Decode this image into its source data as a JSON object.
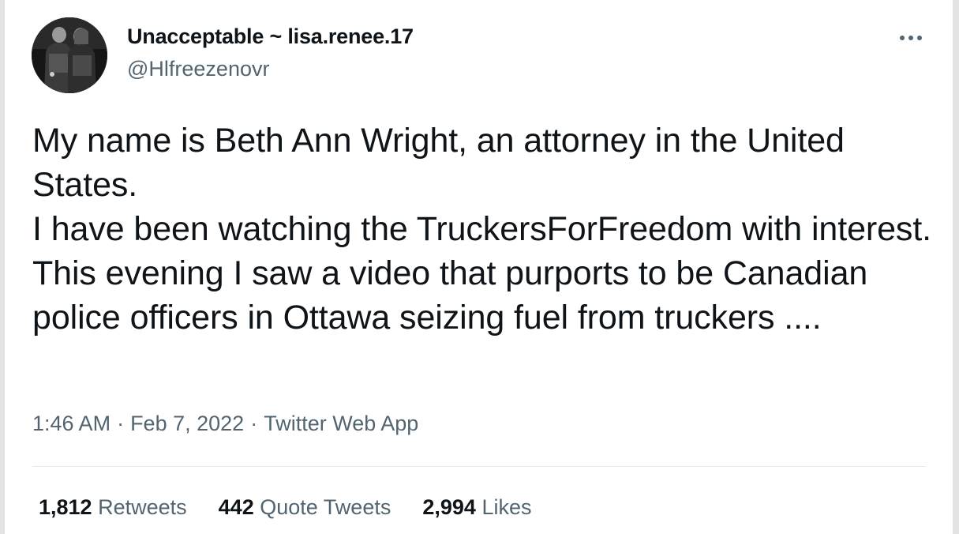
{
  "tweet": {
    "author": {
      "display_name": "Unacceptable ~ lisa.renee.17",
      "handle": "@Hlfreezenovr",
      "avatar": "profile-photo"
    },
    "more_icon": "more-options-icon",
    "text": "My name is Beth Ann Wright, an attorney in the United States.\nI have been watching the TruckersForFreedom with interest. This evening I saw a video that purports to be Canadian police officers in Ottawa seizing fuel from truckers ....",
    "meta": {
      "time": "1:46 AM",
      "separator": "·",
      "date": "Feb 7, 2022",
      "source": "Twitter Web App"
    },
    "stats": {
      "retweets_count": "1,812",
      "retweets_label": "Retweets",
      "quote_count": "442",
      "quote_label": "Quote Tweets",
      "likes_count": "2,994",
      "likes_label": "Likes"
    }
  },
  "colors": {
    "primary_text": "#0f1419",
    "secondary_text": "#536471",
    "divider": "#e6e9eb",
    "frame_border": "#e1e3e5"
  }
}
